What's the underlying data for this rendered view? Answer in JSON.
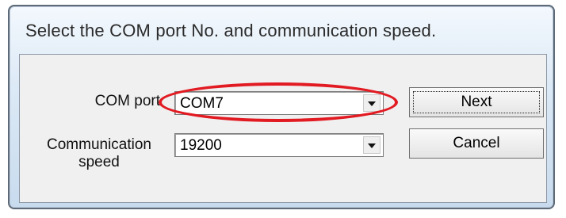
{
  "dialog": {
    "title": "Select the COM port No. and communication speed."
  },
  "com_port": {
    "label": "COM port",
    "value": "COM7"
  },
  "comm_speed": {
    "label_line1": "Communication",
    "label_line2": "speed",
    "value": "19200"
  },
  "buttons": {
    "next_label": "Next",
    "cancel_label": "Cancel"
  },
  "icons": {
    "dropdown": "chevron-down-icon"
  },
  "colors": {
    "highlight": "#e21a22"
  }
}
